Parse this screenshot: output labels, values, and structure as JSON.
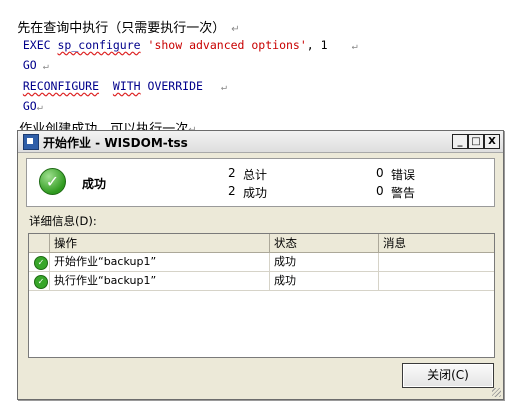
{
  "doc": {
    "heading": "先在查询中执行（只需要执行一次）",
    "code": {
      "exec_kw": "EXEC",
      "proc": "sp_configure",
      "str_arg": "'show advanced options'",
      "num_arg": ", 1",
      "go1": "GO",
      "reconfigure": "RECONFIGURE",
      "with": "WITH",
      "override": "OVERRIDE",
      "go2": "GO"
    },
    "note": "作业创建成功，可以执行一次",
    "paragraph_mark": "↵"
  },
  "dialog": {
    "title": "开始作业 - WISDOM-tss",
    "controls": {
      "minimize": "_",
      "maximize": "□",
      "close": "X"
    },
    "summary": {
      "status": "成功",
      "total_count": "2",
      "total_label": "总计",
      "success_count": "2",
      "success_label": "成功",
      "error_count": "0",
      "error_label": "错误",
      "warning_count": "0",
      "warning_label": "警告"
    },
    "details_label": "详细信息(D):",
    "table": {
      "headers": [
        "操作",
        "状态",
        "消息"
      ],
      "rows": [
        {
          "action": "开始作业“backup1”",
          "status": "成功",
          "message": ""
        },
        {
          "action": "执行作业“backup1”",
          "status": "成功",
          "message": ""
        }
      ]
    },
    "close_button": "关闭(C)"
  },
  "colors": {
    "code_blue": "#00008b",
    "string_red": "#c80000",
    "success_green": "#2f9a1f"
  }
}
